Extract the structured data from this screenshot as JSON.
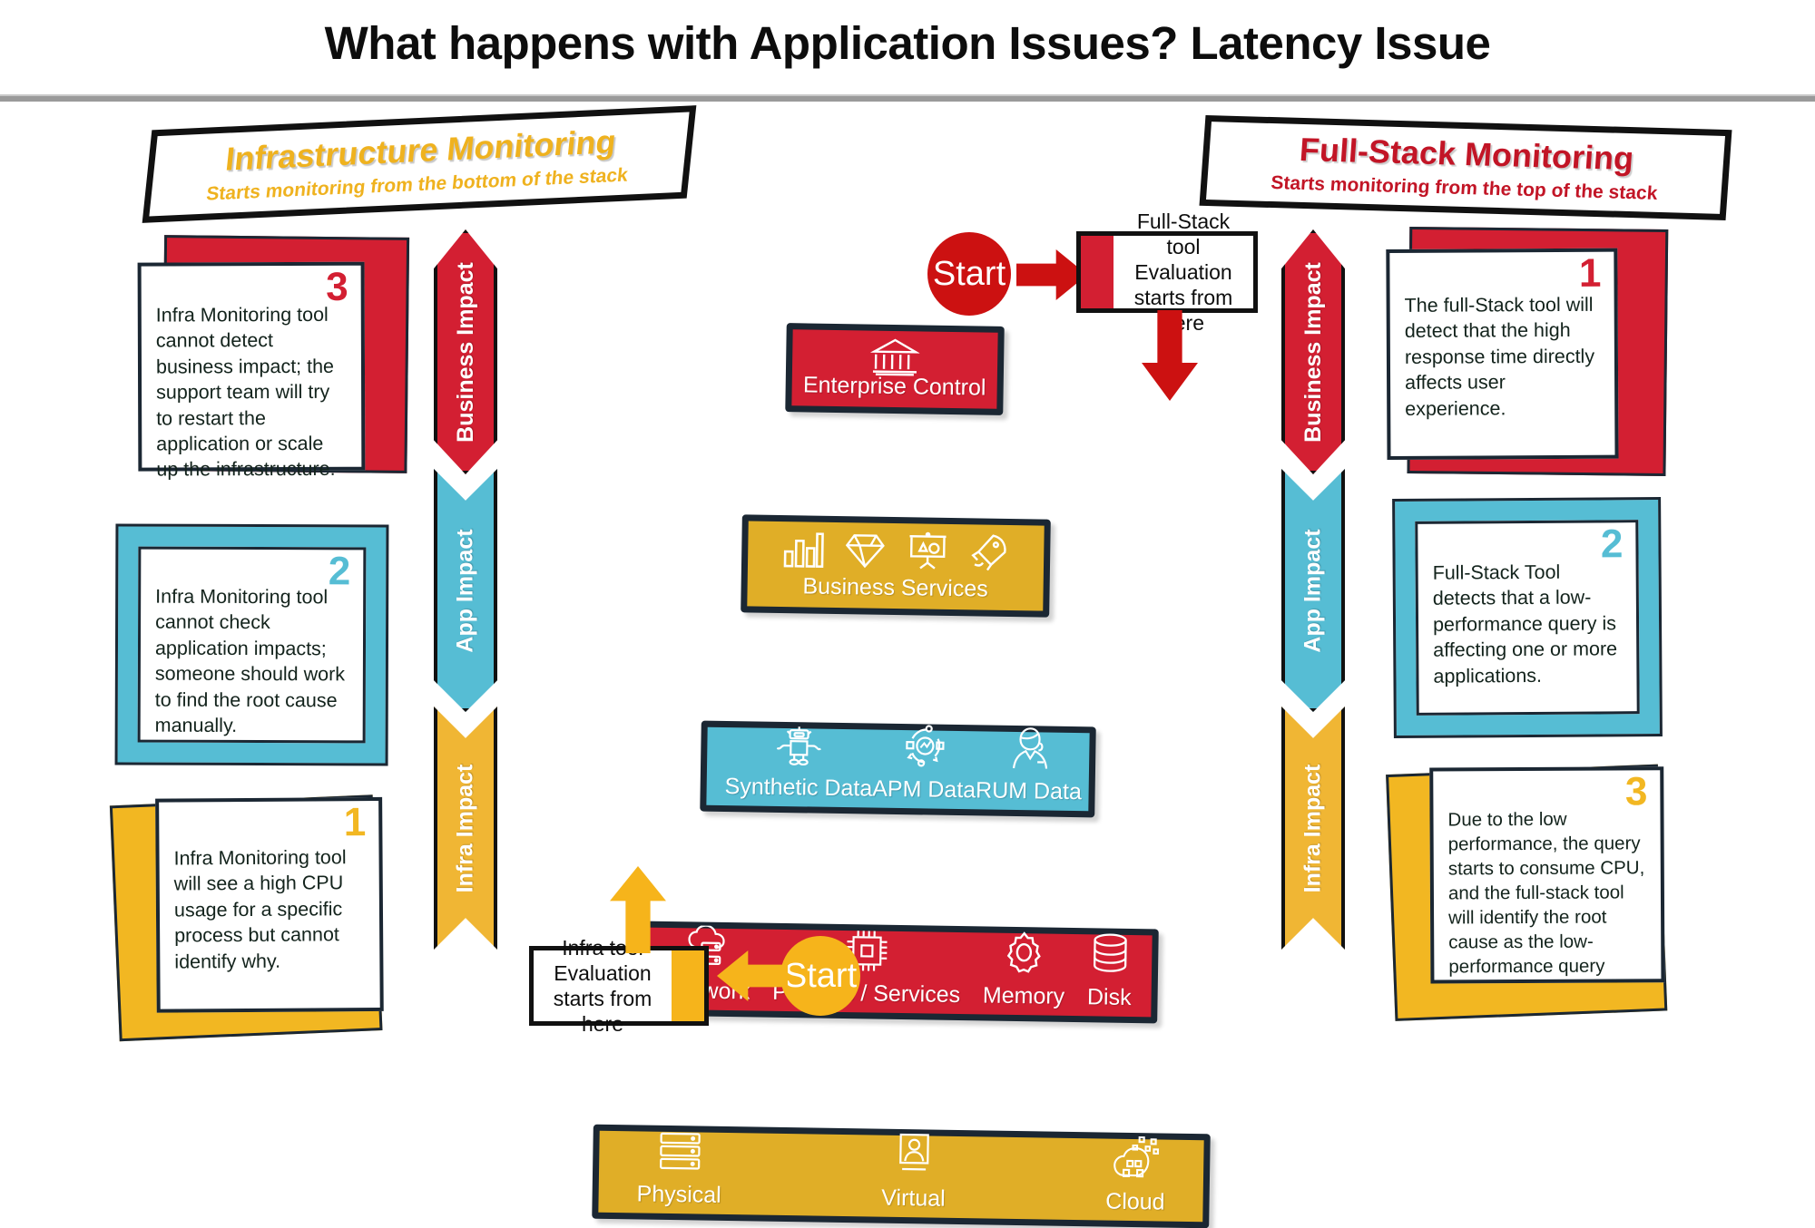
{
  "title": "What happens with Application Issues? Latency Issue",
  "colors": {
    "red": "#d31f32",
    "yellow": "#e0ae27",
    "cyan": "#56bdd4",
    "dark": "#1b2733",
    "banner_yellow": "#efb21f",
    "banner_red": "#c21526"
  },
  "banners": {
    "left": {
      "title": "Infrastructure Monitoring",
      "subtitle": "Starts monitoring from the bottom of the stack"
    },
    "right": {
      "title": "Full-Stack Monitoring",
      "subtitle": "Starts monitoring from the top of the stack"
    }
  },
  "impact_bar": {
    "segments": [
      {
        "label": "Business Impact",
        "color": "#d31f32"
      },
      {
        "label": "App Impact",
        "color": "#56bdd4"
      },
      {
        "label": "Infra Impact",
        "color": "#e0ae27"
      }
    ]
  },
  "pyramid": {
    "rows": [
      {
        "caption": "Enterprise Control",
        "color": "#d31f32",
        "icons": [
          "bank-icon"
        ],
        "cells": []
      },
      {
        "caption": "Business Services",
        "color": "#e0ae27",
        "icons": [
          "bar-chart-icon",
          "diamond-icon",
          "presentation-icon",
          "rocket-icon"
        ],
        "cells": []
      },
      {
        "caption": "",
        "color": "#56bdd4",
        "icons": [],
        "cells": [
          {
            "label": "Synthetic Data",
            "icon": "robot-icon"
          },
          {
            "label": "APM Data",
            "icon": "apm-cycle-icon"
          },
          {
            "label": "RUM Data",
            "icon": "support-agent-icon"
          }
        ]
      },
      {
        "caption": "",
        "color": "#d31f32",
        "icons": [],
        "cells": [
          {
            "label": "Network",
            "icon": "cloud-server-icon"
          },
          {
            "label": "Process / Services",
            "icon": "cpu-chip-icon"
          },
          {
            "label": "Memory",
            "icon": "gear-icon"
          },
          {
            "label": "Disk",
            "icon": "database-icon"
          }
        ]
      },
      {
        "caption": "",
        "color": "#e0ae27",
        "icons": [],
        "cells": [
          {
            "label": "Physical",
            "icon": "server-rack-icon"
          },
          {
            "label": "Virtual",
            "icon": "user-frame-icon"
          },
          {
            "label": "Cloud",
            "icon": "cloud-nodes-icon"
          }
        ]
      }
    ]
  },
  "left_cards": [
    {
      "number": "3",
      "color": "#d31f32",
      "text": "Infra Monitoring tool cannot detect business impact; the support team will try to restart the application or scale up the infrastructure."
    },
    {
      "number": "2",
      "color": "#56bdd4",
      "text": "Infra Monitoring tool cannot check application impacts; someone should work to find the root cause manually."
    },
    {
      "number": "1",
      "color": "#f2b722",
      "text": "Infra Monitoring tool will see a high CPU usage for a specific process but cannot identify why."
    }
  ],
  "right_cards": [
    {
      "number": "1",
      "color": "#d31f32",
      "text": "The full-Stack tool will detect that the high response time directly affects user experience."
    },
    {
      "number": "2",
      "color": "#56bdd4",
      "text": "Full-Stack Tool detects that a low-performance query is affecting one or more applications."
    },
    {
      "number": "3",
      "color": "#f2b722",
      "text": "Due to the low performance, the query starts to consume CPU, and the full-stack tool will identify the root cause as the low-performance query"
    }
  ],
  "flow": {
    "top": {
      "start_label": "Start",
      "start_color": "#cc1111",
      "callout_line1": "Full-Stack tool",
      "callout_line2": "Evaluation",
      "callout_line3": "starts from here"
    },
    "bottom": {
      "start_label": "Start",
      "start_color": "#f6b41b",
      "callout_line1": "Infra tool",
      "callout_line2": "Evaluation",
      "callout_line3": "starts from here"
    }
  }
}
